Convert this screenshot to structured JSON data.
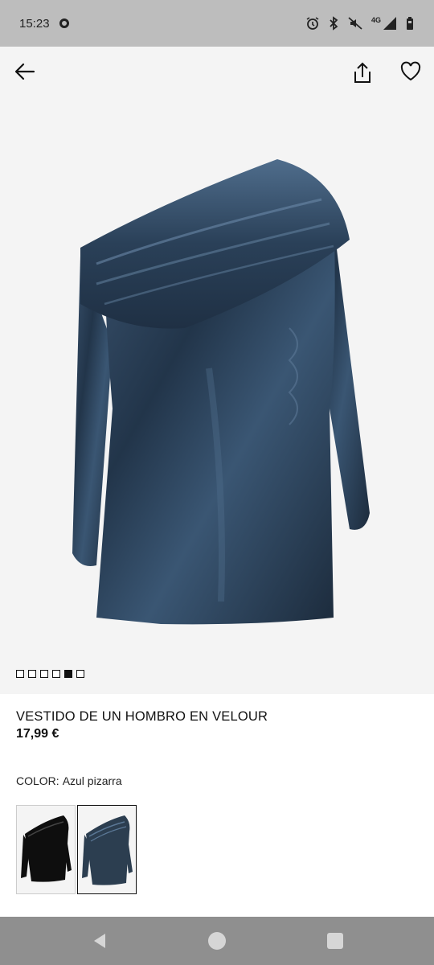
{
  "status_bar": {
    "time": "15:23",
    "network": "4G"
  },
  "product": {
    "title": "VESTIDO DE UN HOMBRO EN VELOUR",
    "price": "17,99 €",
    "color_label": "COLOR:",
    "color_value": "Azul pizarra",
    "image_count": 6,
    "active_image_index": 5,
    "main_color": "#2c3e50",
    "swatches": [
      {
        "color": "#0e0e0e",
        "selected": false
      },
      {
        "color": "#2c3e50",
        "selected": true
      }
    ]
  },
  "icons": {
    "back": "arrow-left-icon",
    "share": "share-icon",
    "favorite": "heart-icon"
  }
}
